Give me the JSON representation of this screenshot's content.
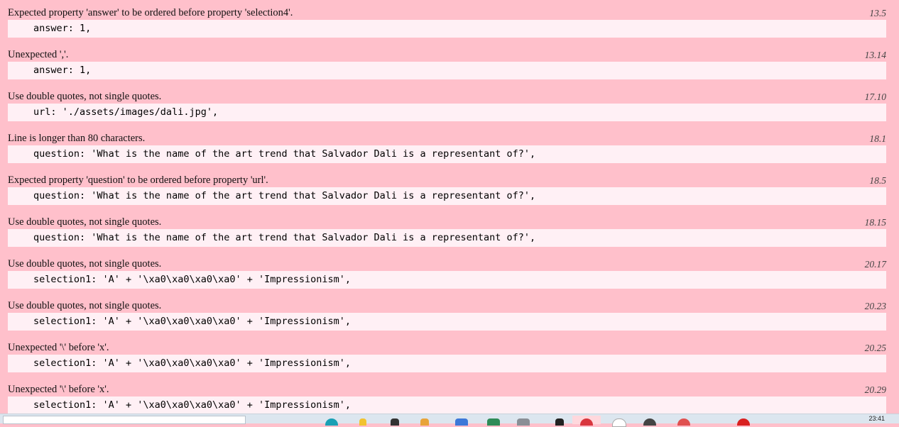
{
  "lint_results": [
    {
      "message": "Expected property 'answer' to be ordered before property 'selection4'.",
      "position": "13.5",
      "code": "answer: 1,"
    },
    {
      "message": "Unexpected ','.",
      "position": "13.14",
      "code": "answer: 1,"
    },
    {
      "message": "Use double quotes, not single quotes.",
      "position": "17.10",
      "code": "url: './assets/images/dali.jpg',"
    },
    {
      "message": "Line is longer than 80 characters.",
      "position": "18.1",
      "code": "question: 'What is the name of the art trend that Salvador Dali is a representant of?',"
    },
    {
      "message": "Expected property 'question' to be ordered before property 'url'.",
      "position": "18.5",
      "code": "question: 'What is the name of the art trend that Salvador Dali is a representant of?',"
    },
    {
      "message": "Use double quotes, not single quotes.",
      "position": "18.15",
      "code": "question: 'What is the name of the art trend that Salvador Dali is a representant of?',"
    },
    {
      "message": "Use double quotes, not single quotes.",
      "position": "20.17",
      "code": "selection1: 'A' + '\\xa0\\xa0\\xa0\\xa0' + 'Impressionism',"
    },
    {
      "message": "Use double quotes, not single quotes.",
      "position": "20.23",
      "code": "selection1: 'A' + '\\xa0\\xa0\\xa0\\xa0' + 'Impressionism',"
    },
    {
      "message": "Unexpected '\\' before 'x'.",
      "position": "20.25",
      "code": "selection1: 'A' + '\\xa0\\xa0\\xa0\\xa0' + 'Impressionism',"
    },
    {
      "message": "Unexpected '\\' before 'x'.",
      "position": "20.29",
      "code": "selection1: 'A' + '\\xa0\\xa0\\xa0\\xa0' + 'Impressionism',"
    }
  ],
  "colors": {
    "background": "#ffc0cb",
    "code_background": "#fff0f5"
  },
  "taskbar": {
    "clock": "23:41",
    "icons": [
      "search-box",
      "app-icon-teal",
      "app-icon-yellow",
      "app-icon-dark",
      "app-icon-orange",
      "app-icon-blue",
      "app-icon-green",
      "app-icon-gray",
      "app-icon-black",
      "app-icon-red",
      "app-icon-white",
      "app-icon-dark2",
      "app-icon-red2",
      "app-icon-red3"
    ]
  }
}
